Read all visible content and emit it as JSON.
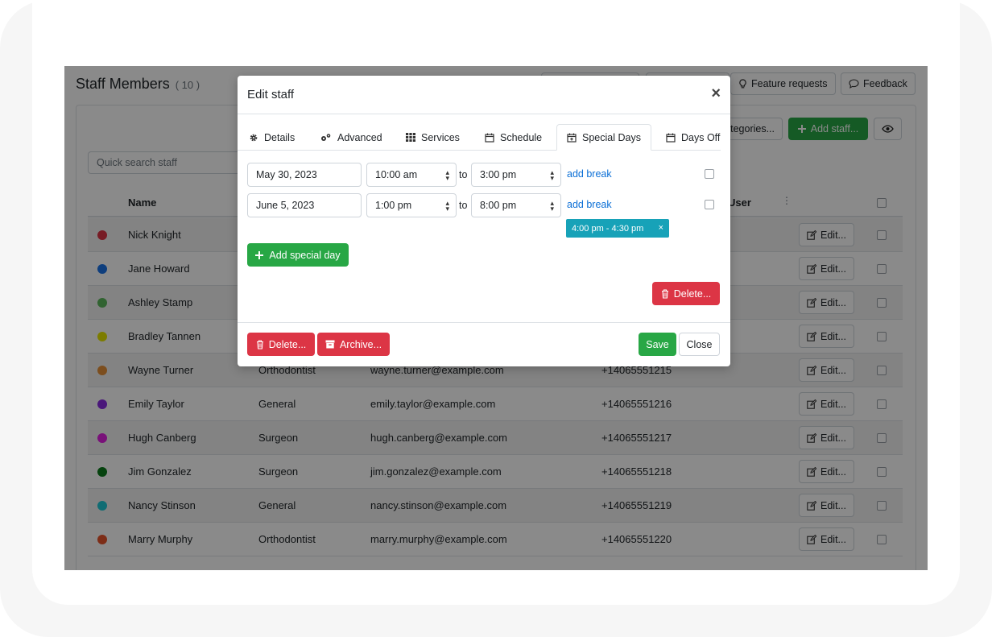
{
  "page": {
    "title": "Staff Members",
    "count": "( 10 )",
    "top_buttons": {
      "feature_requests": "Feature requests",
      "feedback": "Feedback"
    },
    "search_placeholder": "Quick search staff",
    "categories_label": "tegories...",
    "add_staff_label": "Add staff...",
    "table": {
      "headers": {
        "name": "Name",
        "user": "User",
        "more": "⋮"
      },
      "edit_label": "Edit...",
      "rows": [
        {
          "name": "Nick Knight",
          "category": "",
          "email": "",
          "phone": "",
          "color": "#dc3545"
        },
        {
          "name": "Jane Howard",
          "category": "",
          "email": "",
          "phone": "",
          "color": "#1a73e8"
        },
        {
          "name": "Ashley Stamp",
          "category": "",
          "email": "",
          "phone": "",
          "color": "#5cb85c"
        },
        {
          "name": "Bradley Tannen",
          "category": "",
          "email": "",
          "phone": "",
          "color": "#e6e600"
        },
        {
          "name": "Wayne Turner",
          "category": "Orthodontist",
          "email": "wayne.turner@example.com",
          "phone": "+14065551215",
          "color": "#e69138"
        },
        {
          "name": "Emily Taylor",
          "category": "General",
          "email": "emily.taylor@example.com",
          "phone": "+14065551216",
          "color": "#8a2be2"
        },
        {
          "name": "Hugh Canberg",
          "category": "Surgeon",
          "email": "hugh.canberg@example.com",
          "phone": "+14065551217",
          "color": "#e020e0"
        },
        {
          "name": "Jim Gonzalez",
          "category": "Surgeon",
          "email": "jim.gonzalez@example.com",
          "phone": "+14065551218",
          "color": "#0b7a1a"
        },
        {
          "name": "Nancy Stinson",
          "category": "General",
          "email": "nancy.stinson@example.com",
          "phone": "+14065551219",
          "color": "#1fc7d4"
        },
        {
          "name": "Marry Murphy",
          "category": "Orthodontist",
          "email": "marry.murphy@example.com",
          "phone": "+14065551220",
          "color": "#e8542c"
        }
      ]
    }
  },
  "modal": {
    "title": "Edit staff",
    "close_glyph": "×",
    "tabs": [
      {
        "label": "Details",
        "icon": "gear-icon"
      },
      {
        "label": "Advanced",
        "icon": "gears-icon"
      },
      {
        "label": "Services",
        "icon": "grid-icon"
      },
      {
        "label": "Schedule",
        "icon": "calendar-icon"
      },
      {
        "label": "Special Days",
        "icon": "calendar-plus-icon",
        "active": true
      },
      {
        "label": "Days Off",
        "icon": "calendar-icon"
      }
    ],
    "special_days": [
      {
        "date": "May 30, 2023",
        "start": "10:00 am",
        "end": "3:00 pm"
      },
      {
        "date": "June 5, 2023",
        "start": "1:00 pm",
        "end": "8:00 pm"
      }
    ],
    "to_label": "to",
    "add_break_label": "add break",
    "break_badge": "4:00 pm - 4:30 pm",
    "break_remove": "×",
    "add_special_day_label": "Add special day",
    "delete_inner_label": "Delete...",
    "footer": {
      "delete_label": "Delete...",
      "archive_label": "Archive...",
      "save_label": "Save",
      "close_label": "Close"
    }
  },
  "colors": {
    "success": "#28a745",
    "danger": "#dc3545",
    "info": "#17a2b8",
    "link": "#0b6fd6"
  }
}
